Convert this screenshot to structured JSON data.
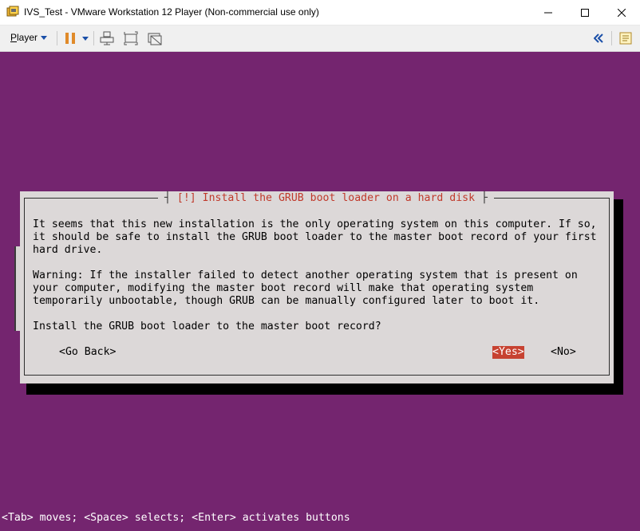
{
  "window": {
    "title": "IVS_Test - VMware Workstation 12 Player (Non-commercial use only)",
    "app_icon": "vmware-player-icon",
    "controls": {
      "minimize": "—",
      "maximize": "☐",
      "close": "✕"
    }
  },
  "toolbar": {
    "player_menu_prefix": "P",
    "player_menu_rest": "layer",
    "icons": [
      "pause-icon",
      "dropdown-caret-icon",
      "send-ctrl-alt-del-icon",
      "fit-guest-icon",
      "unity-mode-icon",
      "collapse-panel-icon",
      "message-log-icon"
    ]
  },
  "console": {
    "background_color": "#74256f",
    "dialog": {
      "title": "[!] Install the GRUB boot loader on a hard disk",
      "lines": [
        "It seems that this new installation is the only operating system on this computer. If so,",
        "it should be safe to install the GRUB boot loader to the master boot record of your first",
        "hard drive.",
        "Warning: If the installer failed to detect another operating system that is present on",
        "your computer, modifying the master boot record will make that operating system",
        "temporarily unbootable, though GRUB can be manually configured later to boot it.",
        "Install the GRUB boot loader to the master boot record?"
      ],
      "buttons": {
        "go_back": "<Go Back>",
        "yes": "<Yes>",
        "no": "<No>"
      },
      "selected_button": "yes",
      "highlight_color": "#c74231"
    },
    "status_line": "<Tab> moves; <Space> selects; <Enter> activates buttons"
  }
}
